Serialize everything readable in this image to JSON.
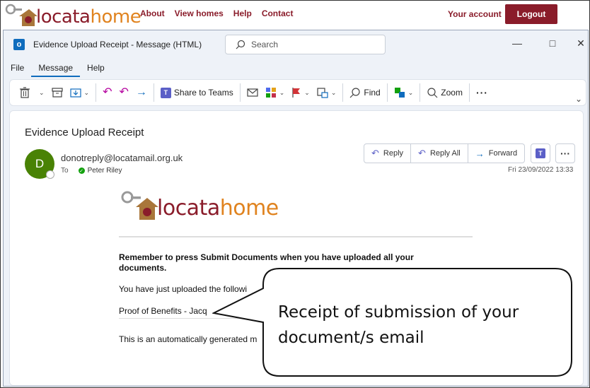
{
  "site": {
    "logo_part1": "locata",
    "logo_part2": "home",
    "nav": [
      "About",
      "View homes",
      "Help",
      "Contact"
    ],
    "account": "Your account",
    "logout": "Logout"
  },
  "window": {
    "title": "Evidence Upload Receipt  -  Message (HTML)",
    "search_placeholder": "Search",
    "menu": [
      "File",
      "Message",
      "Help"
    ],
    "active_menu": "Message"
  },
  "ribbon": {
    "share_to_teams": "Share to Teams",
    "find": "Find",
    "zoom": "Zoom"
  },
  "email": {
    "subject": "Evidence Upload Receipt",
    "avatar_initial": "D",
    "avatar_color": "#498205",
    "sender": "donotreply@locatamail.org.uk",
    "to_label": "To",
    "recipient": "Peter Riley",
    "reply": "Reply",
    "reply_all": "Reply All",
    "forward": "Forward",
    "date": "Fri 23/09/2022 13:33",
    "remember": "Remember to press Submit Documents when you have uploaded all your documents.",
    "uploaded": "You have just uploaded the followi",
    "doc": "Proof of Benefits - Jacq",
    "auto": "This is an automatically generated m"
  },
  "callout": {
    "text": "Receipt of submission of your document/s email"
  },
  "colors": {
    "brand_maroon": "#8a1c2a",
    "brand_orange": "#e0831f",
    "outlook_blue": "#0f6cbd"
  }
}
